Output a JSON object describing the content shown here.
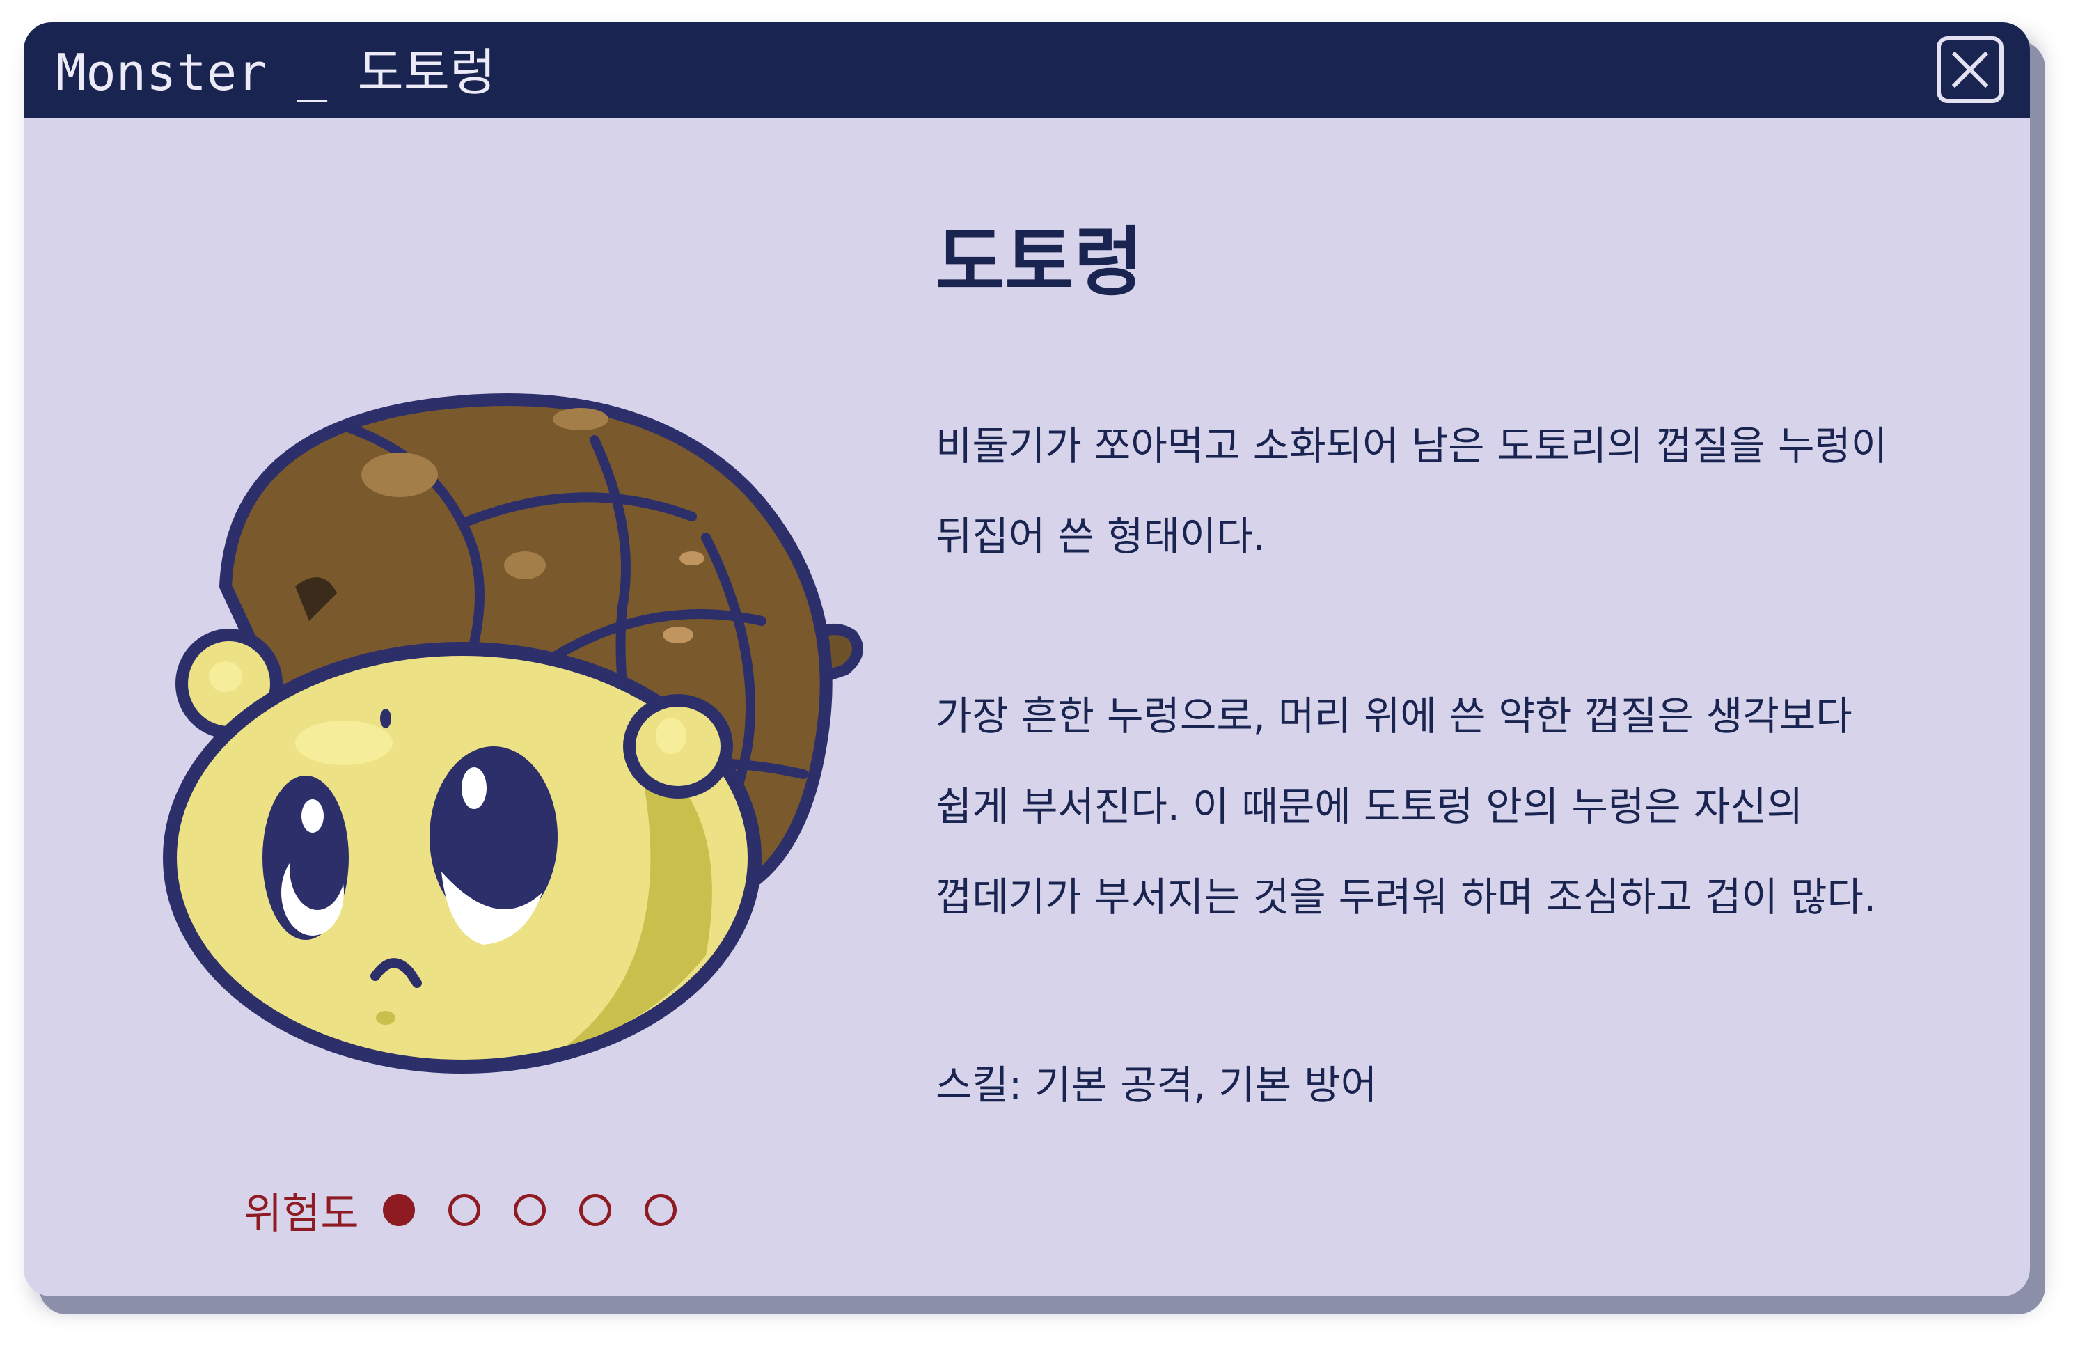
{
  "window": {
    "title": "Monster _ 도토렁",
    "close_icon": "close-icon"
  },
  "monster": {
    "name": "도토렁",
    "description_1": [
      "비둘기가 쪼아먹고 소화되어 남은 도토리의 껍질을 누렁이",
      "뒤집어 쓴 형태이다."
    ],
    "description_2": [
      "가장 흔한 누렁으로, 머리 위에 쓴 약한 껍질은 생각보다",
      "쉽게 부서진다. 이 때문에 도토렁 안의 누렁은 자신의",
      "껍데기가 부서지는 것을 두려워 하며 조심하고 겁이 많다."
    ],
    "skill": "스킬: 기본 공격, 기본 방어",
    "danger": {
      "label": "위험도",
      "level": 1,
      "max": 5
    }
  },
  "colors": {
    "titlebar": "#1a2450",
    "panel": "#d6d3ea",
    "text": "#1a2450",
    "danger": "#8e1a22"
  }
}
